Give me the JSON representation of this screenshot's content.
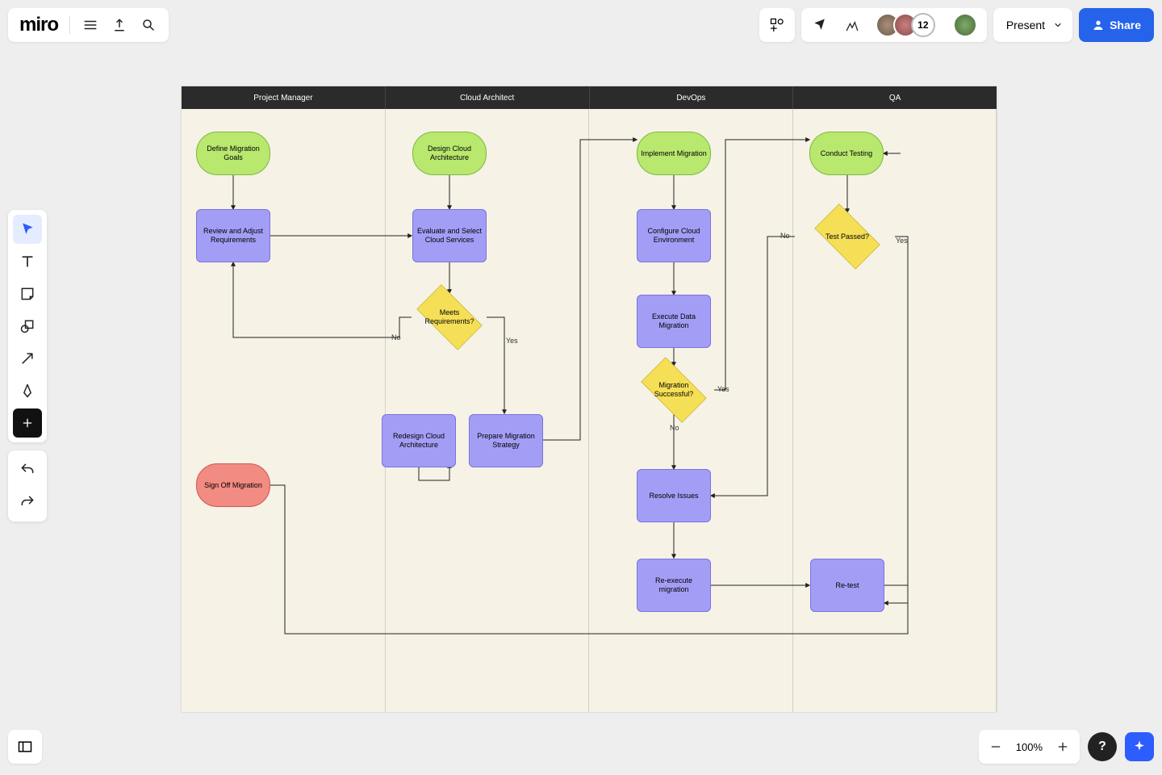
{
  "app": {
    "logo": "miro"
  },
  "topbar": {
    "present_label": "Present",
    "share_label": "Share",
    "collaborator_count": "12"
  },
  "zoom": {
    "level": "100%"
  },
  "swimlanes": [
    "Project Manager",
    "Cloud Architect",
    "DevOps",
    "QA"
  ],
  "nodes": {
    "define_goals": "Define Migration Goals",
    "review_req": "Review and Adjust Requirements",
    "design_arch": "Design Cloud Architecture",
    "evaluate": "Evaluate and Select Cloud Services",
    "meets_req": "Meets Requirements?",
    "redesign": "Redesign Cloud Architecture",
    "prepare": "Prepare Migration Strategy",
    "implement": "Implement Migration",
    "configure": "Configure Cloud Environment",
    "execute": "Execute Data Migration",
    "mig_success": "Migration Successful?",
    "resolve": "Resolve Issues",
    "reexecute": "Re-execute migration",
    "conduct": "Conduct Testing",
    "test_passed": "Test Passed?",
    "retest": "Re-test",
    "signoff": "Sign Off Migration"
  },
  "labels": {
    "yes": "Yes",
    "no": "No"
  }
}
